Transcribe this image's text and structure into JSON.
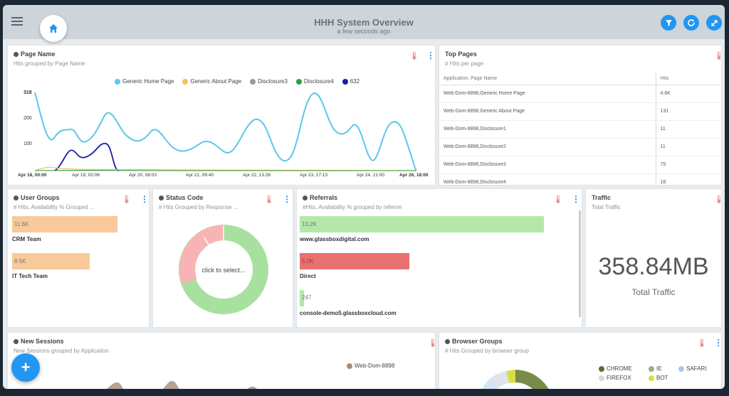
{
  "header": {
    "title": "HHH System Overview",
    "subtitle": "a few seconds ago"
  },
  "page_name_panel": {
    "title": "Page Name",
    "subtitle": "Hits grouped by Page Name",
    "legend": [
      {
        "name": "Generic Home Page",
        "color": "#5bc8e8"
      },
      {
        "name": "Generic About Page",
        "color": "#f4c060"
      },
      {
        "name": "Disclosure3",
        "color": "#999999"
      },
      {
        "name": "Disclosure4",
        "color": "#2e9e3e"
      },
      {
        "name": "632",
        "color": "#1a1aa8"
      }
    ],
    "y_ticks": [
      "318",
      "200",
      "100"
    ],
    "x_ticks": [
      "Apr 18, 00:00",
      "Apr 19, 02:06",
      "Apr 20, 06:03",
      "Apr 21, 09:40",
      "Apr 22, 13:26",
      "Apr 23, 17:13",
      "Apr 24, 21:00",
      "Apr 26, 18:00"
    ]
  },
  "top_pages": {
    "title": "Top Pages",
    "subtitle": "# Hits per page",
    "columns": [
      "Application, Page Name",
      "Hits"
    ],
    "rows": [
      [
        "Web-Dom-8898,Generic Home Page",
        "4.6K"
      ],
      [
        "Web-Dom-8898,Generic About Page",
        "131"
      ],
      [
        "Web-Dom-8898,Disclosure1",
        "11"
      ],
      [
        "Web-Dom-8898,Disclosure2",
        "11"
      ],
      [
        "Web-Dom-8898,Disclosure3",
        "75"
      ],
      [
        "Web-Dom-8898,Disclosure4",
        "18"
      ]
    ]
  },
  "user_groups": {
    "title": "User Groups",
    "subtitle": "# Hits, Availability % Grouped ...",
    "items": [
      {
        "value": "11.6K",
        "label": "CRM Team"
      },
      {
        "value": "8.5K",
        "label": "IT Tech Team"
      }
    ]
  },
  "status_code": {
    "title": "Status Code",
    "subtitle": "# Hits Grouped by Response ...",
    "center_text": "click to select..."
  },
  "referrals": {
    "title": "Referrals",
    "subtitle": "#Hits, Availability % grouped by referrer",
    "items": [
      {
        "value": "13.2K",
        "label": "www.glassboxdigital.com"
      },
      {
        "value": "5.0K",
        "label": "Direct"
      },
      {
        "value": "247",
        "label": "console-demo5.glassboxcloud.com"
      }
    ]
  },
  "traffic": {
    "title": "Traffic",
    "subtitle": "Total Traffic",
    "value": "358.84MB",
    "caption": "Total Traffic"
  },
  "new_sessions": {
    "title": "New Sessions",
    "subtitle": "New Sessions grouped by Application",
    "legend_item": "Web-Dom-8898"
  },
  "browser_groups": {
    "title": "Browser Groups",
    "subtitle": "# Hits Grouped by browser group",
    "legend": [
      {
        "name": "CHROME",
        "color": "#5a6e2a"
      },
      {
        "name": "IE",
        "color": "#9cae8a"
      },
      {
        "name": "SAFARI",
        "color": "#a8c8e8"
      },
      {
        "name": "FIREFOX",
        "color": "#d8d8d8"
      },
      {
        "name": "BOT",
        "color": "#d8e040"
      }
    ]
  },
  "fab_label": "+"
}
